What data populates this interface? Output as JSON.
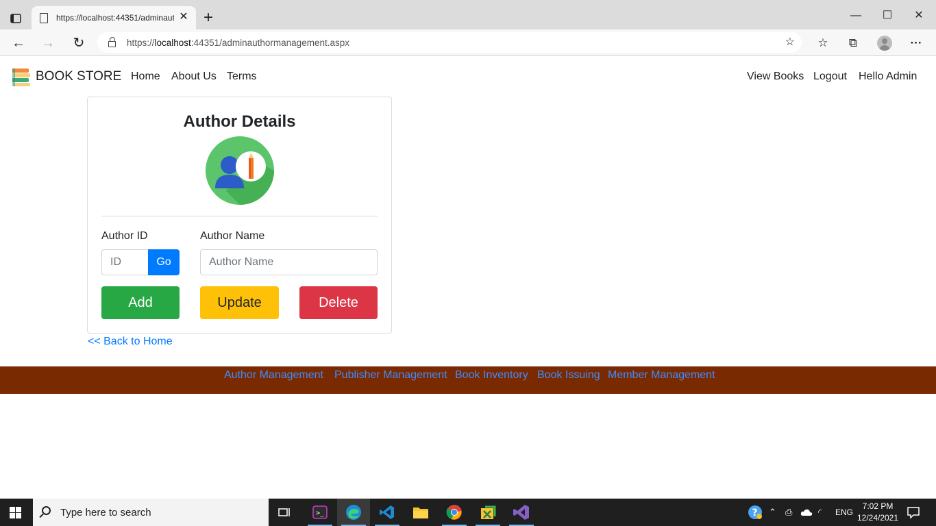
{
  "browser": {
    "tab_title": "https://localhost:44351/adminauthormanagement.aspx",
    "url_prefix": "https://",
    "url_host": "localhost",
    "url_rest": ":44351/adminauthormanagement.aspx"
  },
  "nav": {
    "brand": "BOOK STORE",
    "left_links": [
      "Home",
      "About Us",
      "Terms"
    ],
    "right_links": [
      "View Books",
      "Logout",
      "Hello Admin"
    ]
  },
  "card": {
    "title": "Author Details",
    "author_id_label": "Author ID",
    "author_id_placeholder": "ID",
    "go_label": "Go",
    "author_name_label": "Author Name",
    "author_name_placeholder": "Author Name",
    "add_label": "Add",
    "update_label": "Update",
    "delete_label": "Delete"
  },
  "back_link": "<< Back to Home",
  "footer": {
    "links": [
      "Author Management",
      "Publisher Management",
      "Book Inventory",
      "Book Issuing",
      "Member Management"
    ]
  },
  "taskbar": {
    "search_placeholder": "Type here to search",
    "language": "ENG",
    "time": "7:02 PM",
    "date": "12/24/2021"
  },
  "colors": {
    "primary": "#007bff",
    "success": "#28a745",
    "warning": "#ffc107",
    "danger": "#dc3545",
    "footer_bg": "#7a2a00"
  }
}
